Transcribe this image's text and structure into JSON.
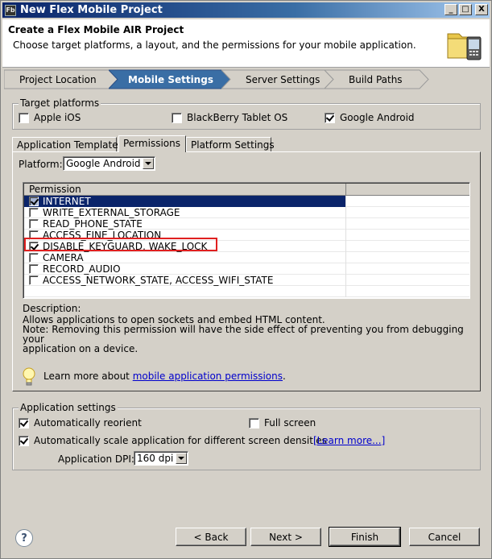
{
  "window": {
    "app_icon": "Fb",
    "title": "New Flex Mobile Project",
    "controls": {
      "minimize": "_",
      "maximize": "□",
      "close": "X"
    }
  },
  "banner": {
    "title": "Create a Flex Mobile AIR Project",
    "subtitle": "Choose target platforms, a layout, and the permissions for your mobile application."
  },
  "steps": [
    "Project Location",
    "Mobile Settings",
    "Server Settings",
    "Build Paths"
  ],
  "active_step": "Mobile Settings",
  "target_platforms": {
    "label": "Target platforms",
    "options": [
      {
        "label": "Apple iOS",
        "checked": false
      },
      {
        "label": "BlackBerry Tablet OS",
        "checked": false
      },
      {
        "label": "Google Android",
        "checked": true
      }
    ]
  },
  "tabs": [
    "Application Template",
    "Permissions",
    "Platform Settings"
  ],
  "active_tab": "Permissions",
  "platform": {
    "label": "Platform:",
    "value": "Google Android"
  },
  "permissions": {
    "header": "Permission",
    "rows": [
      {
        "name": "INTERNET",
        "checked": true,
        "selected": true
      },
      {
        "name": "WRITE_EXTERNAL_STORAGE",
        "checked": false
      },
      {
        "name": "READ_PHONE_STATE",
        "checked": false
      },
      {
        "name": "ACCESS_FINE_LOCATION",
        "checked": false
      },
      {
        "name": "DISABLE_KEYGUARD, WAKE_LOCK",
        "checked": true,
        "highlighted": true
      },
      {
        "name": "CAMERA",
        "checked": false
      },
      {
        "name": "RECORD_AUDIO",
        "checked": false
      },
      {
        "name": "ACCESS_NETWORK_STATE, ACCESS_WIFI_STATE",
        "checked": false
      }
    ]
  },
  "description": {
    "label": "Description:",
    "line1": "Allows applications to open sockets and embed HTML content.",
    "line2": "Note: Removing this permission will have the side effect of preventing you from debugging your",
    "line3": "application on a device."
  },
  "learn_more": {
    "prefix": "Learn more about ",
    "link": "mobile application permissions",
    "suffix": "."
  },
  "app_settings": {
    "label": "Application settings",
    "auto_reorient": {
      "label": "Automatically reorient",
      "checked": true
    },
    "full_screen": {
      "label": "Full screen",
      "checked": false
    },
    "auto_scale": {
      "label": "Automatically scale application for different screen densities",
      "checked": true
    },
    "learn_more_link": "[Learn more...]",
    "dpi_label": "Application DPI:",
    "dpi_value": "160 dpi"
  },
  "buttons": {
    "back": "< Back",
    "next": "Next >",
    "finish": "Finish",
    "cancel": "Cancel"
  },
  "colors": {
    "titlebar": "#0a246a",
    "active_step": "#3a6ea5",
    "selection": "#0a246a",
    "highlight_box": "#e02020",
    "link": "#0000cc"
  }
}
